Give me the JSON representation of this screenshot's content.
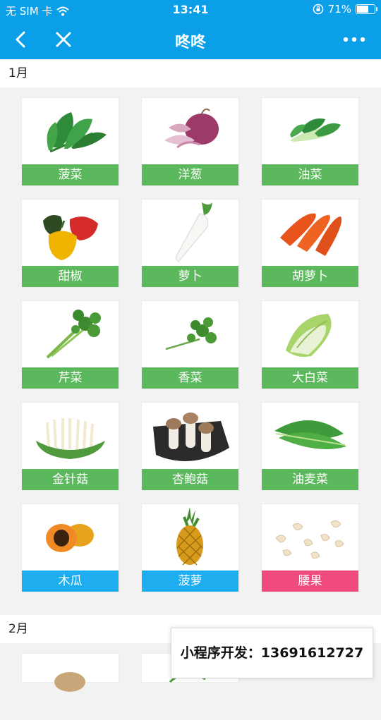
{
  "status": {
    "carrier": "无 SIM 卡",
    "time": "13:41",
    "battery": "71%",
    "battery_level": 0.71
  },
  "nav": {
    "title": "咚咚"
  },
  "sections": [
    {
      "title": "1月",
      "items": [
        {
          "label": "菠菜",
          "icon": "spinach",
          "color": "#5cb85c"
        },
        {
          "label": "洋葱",
          "icon": "onion",
          "color": "#5cb85c"
        },
        {
          "label": "油菜",
          "icon": "bok-choy",
          "color": "#5cb85c"
        },
        {
          "label": "甜椒",
          "icon": "bell-pepper",
          "color": "#5cb85c"
        },
        {
          "label": "萝卜",
          "icon": "radish",
          "color": "#5cb85c"
        },
        {
          "label": "胡萝卜",
          "icon": "carrot",
          "color": "#5cb85c"
        },
        {
          "label": "芹菜",
          "icon": "celery",
          "color": "#5cb85c"
        },
        {
          "label": "香菜",
          "icon": "coriander",
          "color": "#5cb85c"
        },
        {
          "label": "大白菜",
          "icon": "napa-cabbage",
          "color": "#5cb85c"
        },
        {
          "label": "金针菇",
          "icon": "enoki-mushroom",
          "color": "#5cb85c"
        },
        {
          "label": "杏鲍菇",
          "icon": "king-oyster-mushroom",
          "color": "#5cb85c"
        },
        {
          "label": "油麦菜",
          "icon": "leaf-lettuce",
          "color": "#5cb85c"
        },
        {
          "label": "木瓜",
          "icon": "papaya",
          "color": "#1eaef0"
        },
        {
          "label": "菠萝",
          "icon": "pineapple",
          "color": "#1eaef0"
        },
        {
          "label": "腰果",
          "icon": "cashew",
          "color": "#ef4b7f"
        }
      ]
    },
    {
      "title": "2月"
    }
  ],
  "promo": {
    "text": "小程序开发：13691612727"
  }
}
